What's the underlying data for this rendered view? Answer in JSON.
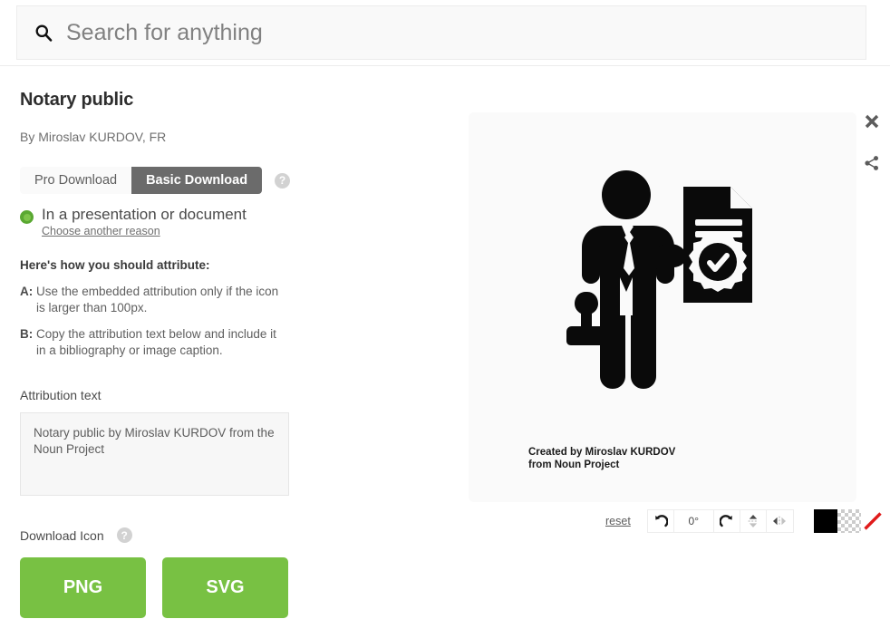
{
  "header": {
    "search": {
      "placeholder": "Search for anything",
      "value": "",
      "icon": "search-icon"
    }
  },
  "details": {
    "title": "Notary public",
    "author": "By Miroslav KURDOV, FR",
    "tabs": [
      {
        "label": "Pro Download",
        "active": false
      },
      {
        "label": "Basic Download",
        "active": true
      }
    ],
    "tabs_help": "?",
    "reason": {
      "selected_label": "In a presentation or document",
      "change_link": "Choose another reason",
      "radio_color": "#5aa832"
    },
    "howto": {
      "title": "Here's how you should attribute:",
      "items": [
        {
          "letter": "A:",
          "text": "Use the embedded attribution only if the icon is larger than 100px."
        },
        {
          "letter": "B:",
          "text": "Copy the attribution text below and include it in a bibliography or image caption."
        }
      ]
    },
    "attribution": {
      "label": "Attribution text",
      "value": "Notary public by Miroslav KURDOV from the Noun Project"
    },
    "download": {
      "label": "Download Icon",
      "help": "?",
      "buttons": [
        {
          "label": "PNG",
          "color": "#78c143"
        },
        {
          "label": "SVG",
          "color": "#78c143"
        }
      ]
    }
  },
  "preview": {
    "caption": "Created by Miroslav KURDOV\nfrom Noun Project",
    "icon_name": "notary-public-icon",
    "actions": [
      {
        "name": "close-icon"
      },
      {
        "name": "share-icon"
      }
    ],
    "toolbar": {
      "reset_label": "reset",
      "rotate_value": "0°",
      "controls": [
        {
          "name": "rotate-left-icon"
        },
        {
          "name": "rotate-value"
        },
        {
          "name": "rotate-right-icon"
        },
        {
          "name": "flip-vertical-icon"
        },
        {
          "name": "flip-horizontal-icon"
        }
      ],
      "swatches": [
        {
          "name": "swatch-black",
          "color": "#000000"
        },
        {
          "name": "swatch-transparent",
          "color": "transparent"
        },
        {
          "name": "swatch-none",
          "color": "#ffffff"
        }
      ]
    }
  }
}
